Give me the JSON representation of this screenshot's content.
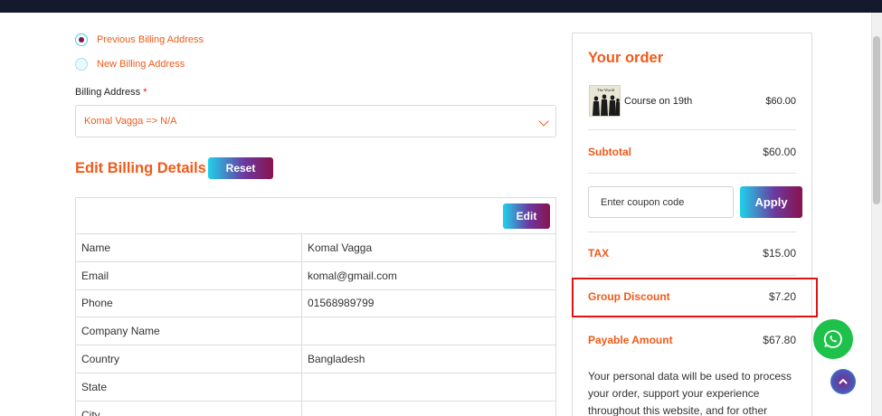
{
  "billing": {
    "previous_address_label": "Previous Billing Address",
    "new_address_label": "New Billing Address",
    "address_field_label": "Billing Address",
    "required_marker": "*",
    "selected_address": "Komal Vagga => N/A"
  },
  "edit_section": {
    "title": "Edit Billing Details",
    "reset_label": "Reset",
    "edit_label": "Edit",
    "rows": [
      {
        "field": "Name",
        "value": "Komal Vagga"
      },
      {
        "field": "Email",
        "value": "komal@gmail.com"
      },
      {
        "field": "Phone",
        "value": "01568989799"
      },
      {
        "field": "Company Name",
        "value": ""
      },
      {
        "field": "Country",
        "value": "Bangladesh"
      },
      {
        "field": "State",
        "value": ""
      },
      {
        "field": "City",
        "value": ""
      }
    ]
  },
  "order": {
    "title": "Your order",
    "item": {
      "name": "Course on 19th",
      "price": "$60.00",
      "thumbnail_caption": "The World"
    },
    "subtotal_label": "Subtotal",
    "subtotal_value": "$60.00",
    "coupon_placeholder": "Enter coupon code",
    "apply_label": "Apply",
    "tax_label": "TAX",
    "tax_value": "$15.00",
    "group_discount_label": "Group Discount",
    "group_discount_value": "$7.20",
    "payable_label": "Payable Amount",
    "payable_value": "$67.80",
    "privacy_text": "Your personal data will be used to process your order, support your experience throughout this website, and for other"
  },
  "floating": {
    "whatsapp_icon": "whatsapp-icon",
    "scroll_top_icon": "chevron-up-icon"
  },
  "colors": {
    "accent": "#f05a1a",
    "gradient_start": "#1fd2ec",
    "gradient_end": "#8a124d",
    "highlight_border": "#e01313",
    "whatsapp_green": "#1ec24b",
    "top_bar": "#141a2b"
  }
}
